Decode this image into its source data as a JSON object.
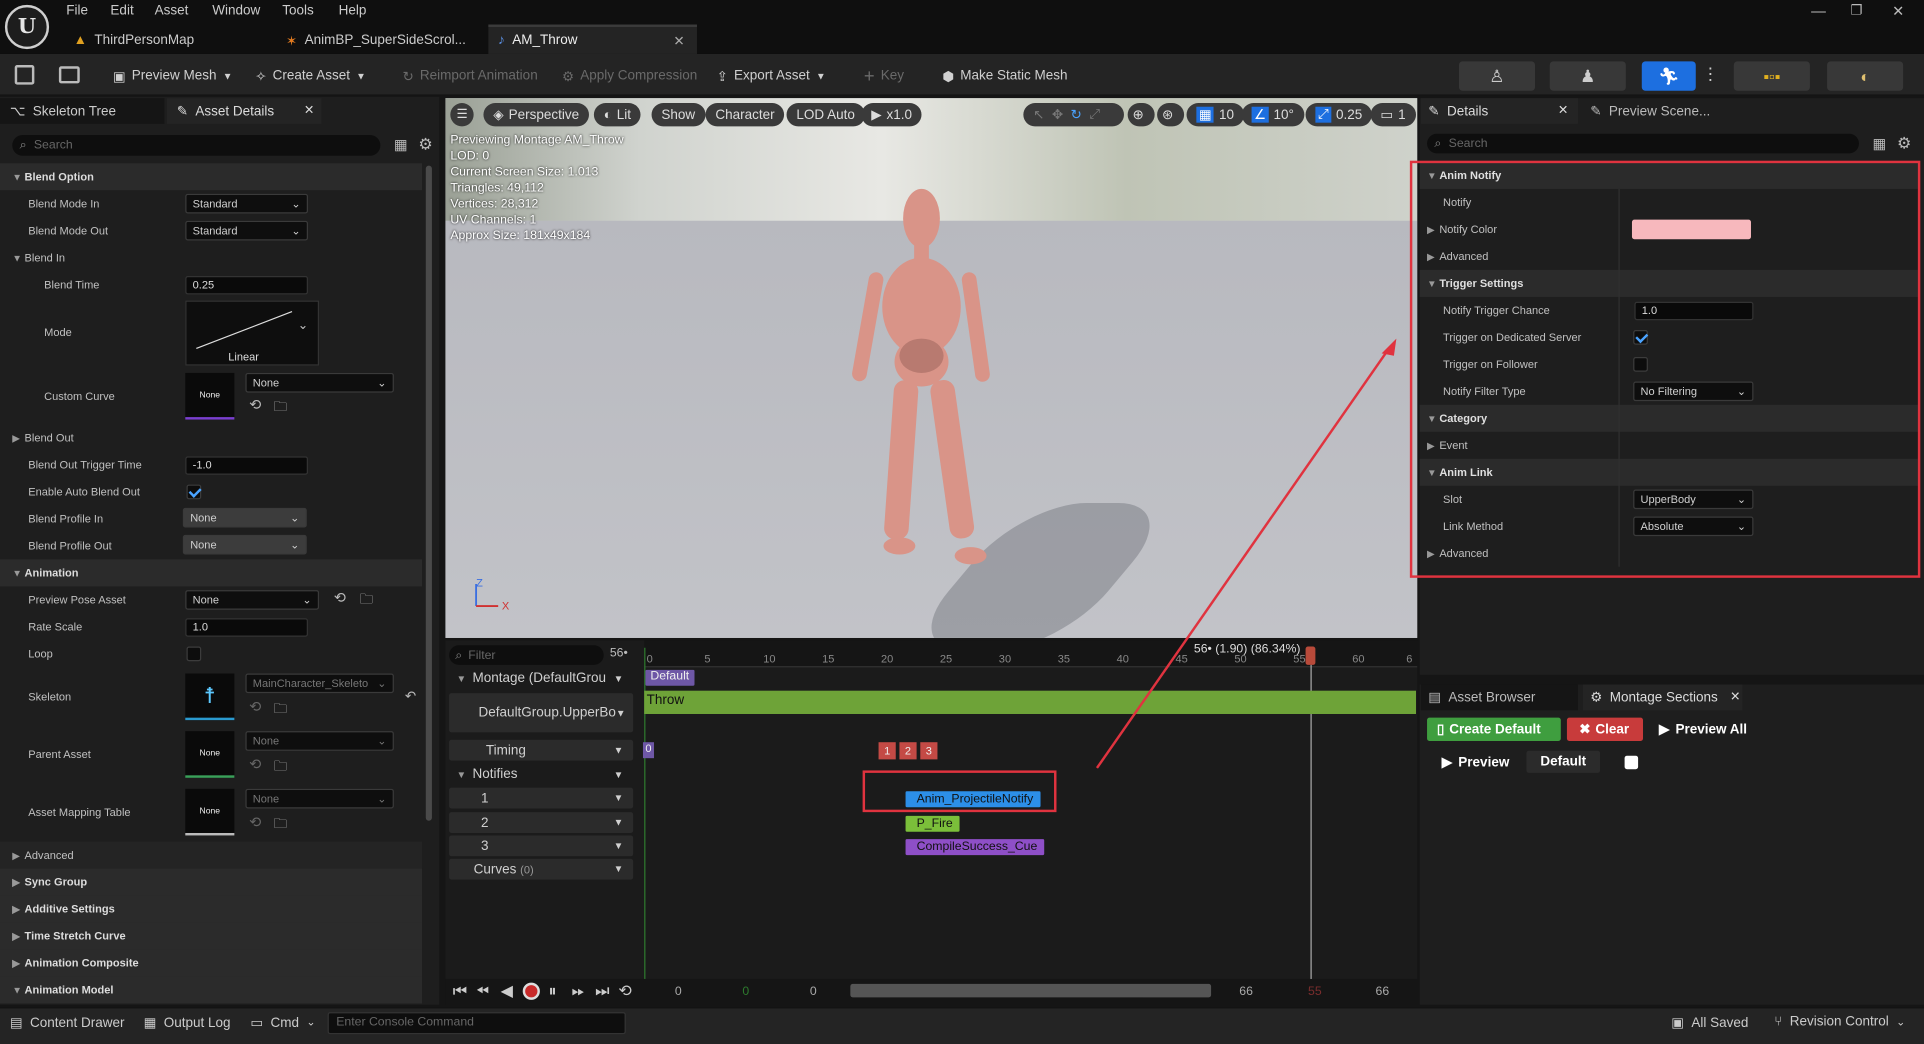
{
  "menu": {
    "items": [
      "File",
      "Edit",
      "Asset",
      "Window",
      "Tools",
      "Help"
    ]
  },
  "tabs": [
    {
      "label": "ThirdPersonMap"
    },
    {
      "label": "AnimBP_SuperSideScrol..."
    },
    {
      "label": "AM_Throw"
    }
  ],
  "toolbar": {
    "preview_mesh": "Preview Mesh",
    "create_asset": "Create Asset",
    "reimport": "Reimport Animation",
    "apply_compression": "Apply Compression",
    "export_asset": "Export Asset",
    "key": "Key",
    "make_static_mesh": "Make Static Mesh"
  },
  "left_panel": {
    "tab_skeleton_tree": "Skeleton Tree",
    "tab_asset_details": "Asset Details",
    "search_placeholder": "Search",
    "blend_option": "Blend Option",
    "blend_mode_in": "Blend Mode In",
    "blend_mode_in_value": "Standard",
    "blend_mode_out": "Blend Mode Out",
    "blend_mode_out_value": "Standard",
    "blend_in": "Blend In",
    "blend_time": "Blend Time",
    "blend_time_value": "0.25",
    "mode": "Mode",
    "mode_value": "Linear",
    "custom_curve": "Custom Curve",
    "custom_curve_thumb": "None",
    "custom_curve_value": "None",
    "blend_out": "Blend Out",
    "blend_out_trigger_time": "Blend Out Trigger Time",
    "blend_out_trigger_value": "-1.0",
    "enable_auto_blend_out": "Enable Auto Blend Out",
    "enable_auto_blend_out_checked": true,
    "blend_profile_in": "Blend Profile In",
    "blend_profile_in_value": "None",
    "blend_profile_out": "Blend Profile Out",
    "blend_profile_out_value": "None",
    "animation": "Animation",
    "preview_pose_asset": "Preview Pose Asset",
    "preview_pose_value": "None",
    "rate_scale": "Rate Scale",
    "rate_scale_value": "1.0",
    "loop": "Loop",
    "skeleton": "Skeleton",
    "skeleton_value": "MainCharacter_Skeleto",
    "parent_asset": "Parent Asset",
    "parent_asset_thumb": "None",
    "parent_asset_value": "None",
    "asset_mapping_table": "Asset Mapping Table",
    "asset_mapping_thumb": "None",
    "asset_mapping_value": "None",
    "collapsed": [
      "Advanced",
      "Sync Group",
      "Additive Settings",
      "Time Stretch Curve",
      "Animation Composite"
    ],
    "animation_model": "Animation Model"
  },
  "viewport": {
    "perspective": "Perspective",
    "lit": "Lit",
    "show": "Show",
    "character": "Character",
    "lod": "LOD Auto",
    "speed": "x1.0",
    "grid": "10",
    "angle": "10°",
    "scale": "0.25",
    "cam": "1",
    "info": [
      "Previewing Montage AM_Throw",
      "LOD: 0",
      "Current Screen Size: 1.013",
      "Triangles: 49,112",
      "Vertices: 28,312",
      "UV Channels: 1",
      "Approx Size: 181x49x184"
    ],
    "axis_z": "Z",
    "axis_x": "X"
  },
  "timeline": {
    "filter_placeholder": "Filter",
    "frame": "56",
    "ruler": [
      "0",
      "5",
      "10",
      "15",
      "20",
      "25",
      "30",
      "35",
      "40",
      "45",
      "50",
      "55",
      "60",
      "6"
    ],
    "playhead": "56• (1.90) (86.34%)",
    "montage": "Montage (DefaultGrou",
    "slot": "DefaultGroup.UpperBo",
    "timing": "Timing",
    "notifies": "Notifies",
    "tracks": [
      "1",
      "2",
      "3"
    ],
    "curves": "Curves",
    "curves_count": "(0)",
    "section_default": "Default",
    "segment_throw": "Throw",
    "timing_start": "0",
    "timing_markers": [
      "1",
      "2",
      "3"
    ],
    "notify_items": [
      "Anim_ProjectileNotify",
      "P_Fire",
      "CompileSuccess_Cue"
    ],
    "bottom_values": [
      "0",
      "0",
      "0",
      "66",
      "55",
      "66"
    ]
  },
  "details": {
    "tab": "Details",
    "tab_preview": "Preview Scene...",
    "search_placeholder": "Search",
    "anim_notify": "Anim Notify",
    "notify": "Notify",
    "notify_color": "Notify Color",
    "notify_color_hex": "#f7b8bd",
    "advanced": "Advanced",
    "trigger_settings": "Trigger Settings",
    "notify_trigger_chance": "Notify Trigger Chance",
    "notify_trigger_chance_value": "1.0",
    "trigger_dedicated_server": "Trigger on Dedicated Server",
    "trigger_dedicated_checked": true,
    "trigger_on_follower": "Trigger on Follower",
    "trigger_follower_checked": false,
    "notify_filter_type": "Notify Filter Type",
    "notify_filter_value": "No Filtering",
    "category": "Category",
    "event": "Event",
    "anim_link": "Anim Link",
    "slot": "Slot",
    "slot_value": "UpperBody",
    "link_method": "Link Method",
    "link_method_value": "Absolute",
    "advanced2": "Advanced"
  },
  "sections_panel": {
    "tab_asset_browser": "Asset Browser",
    "tab_montage_sections": "Montage Sections",
    "create_default": "Create Default",
    "clear": "Clear",
    "preview_all": "Preview All",
    "preview": "Preview",
    "default": "Default"
  },
  "statusbar": {
    "content_drawer": "Content Drawer",
    "output_log": "Output Log",
    "cmd": "Cmd",
    "console_placeholder": "Enter Console Command",
    "all_saved": "All Saved",
    "revision_control": "Revision Control"
  },
  "colors": {
    "accent_blue": "#1d6fe0",
    "highlight_red": "#e0333f",
    "montage_green": "#6ea338",
    "section_purple": "#6e57a6",
    "notify_blue": "#2c8fe8",
    "notify_green": "#7bbf3a",
    "notify_purple": "#8e4fc7",
    "create_default_green": "#3f9e3f",
    "clear_red": "#c83b3b"
  }
}
